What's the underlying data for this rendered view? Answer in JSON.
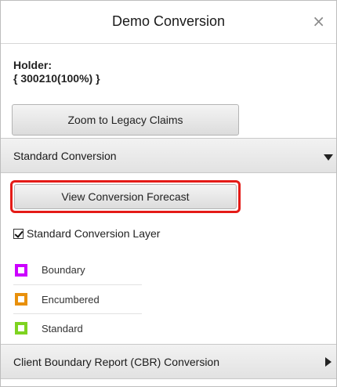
{
  "dialog": {
    "title": "Demo Conversion",
    "close_glyph": "×"
  },
  "holder": {
    "line1": "Holder:",
    "line2": "{ 300210(100%) }"
  },
  "zoom_button": "Zoom to Legacy Claims",
  "standard_section": {
    "label": "Standard Conversion",
    "state": "expanded",
    "forecast_button": "View Conversion Forecast",
    "forecast_highlight_color": "#e41b17",
    "layer_label": "Standard Conversion Layer",
    "layer_checked": true,
    "legend": [
      {
        "label": "Boundary",
        "color": "#cc00ff",
        "icon": "square-outline-icon"
      },
      {
        "label": "Encumbered",
        "color": "#e8900c",
        "icon": "square-outline-icon"
      },
      {
        "label": "Standard",
        "color": "#7ed321",
        "icon": "square-outline-icon"
      }
    ]
  },
  "cbr_section": {
    "label": "Client Boundary Report (CBR) Conversion",
    "state": "collapsed"
  }
}
